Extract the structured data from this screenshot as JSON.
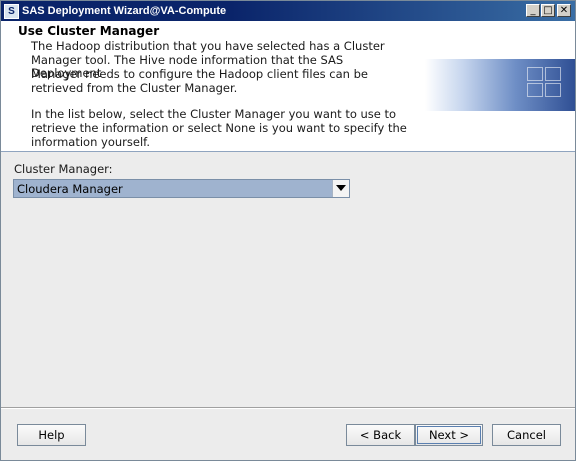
{
  "window": {
    "title": "SAS Deployment Wizard@VA-Compute",
    "app_icon_glyph": "S",
    "minimize_glyph": "_",
    "maximize_glyph": "□",
    "close_glyph": "✕"
  },
  "header": {
    "title": "Use Cluster Manager",
    "paragraph1_lines": [
      "The Hadoop distribution that you have selected has a Cluster",
      "Manager tool. The Hive node information that the SAS Deployment",
      "Manager needs to configure the Hadoop client files can be",
      "retrieved from the Cluster Manager."
    ],
    "paragraph2_lines": [
      "In the list below, select the Cluster Manager you want to use to",
      "retrieve the information or select None is you want to specify the",
      "information yourself."
    ]
  },
  "form": {
    "cluster_manager_label": "Cluster Manager:",
    "cluster_manager_value": "Cloudera Manager",
    "dropdown_icon": "chevron-down-icon"
  },
  "buttons": {
    "help": "Help",
    "back": "< Back",
    "next": "Next >",
    "cancel": "Cancel"
  },
  "colors": {
    "titlebar": "#0a246a",
    "selection": "#9fb3cf",
    "banner_dark": "#2f4f94"
  }
}
